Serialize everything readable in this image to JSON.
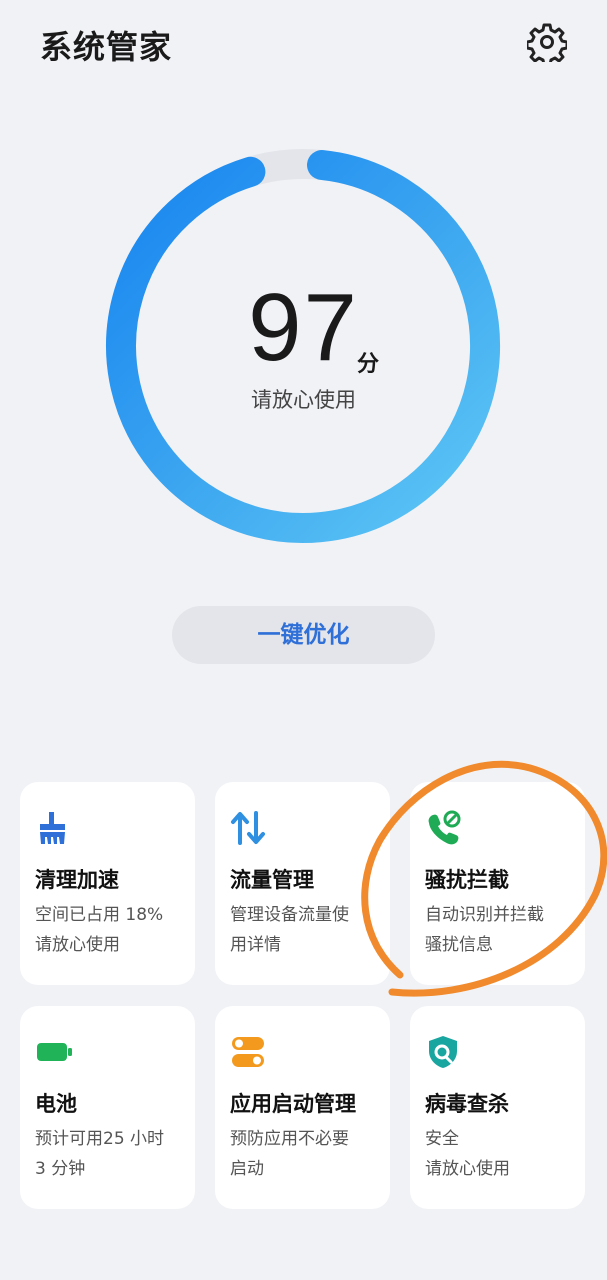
{
  "header": {
    "title": "系统管家",
    "settings_icon": "gear-icon"
  },
  "score": {
    "value": "97",
    "unit": "分",
    "status": "请放心使用",
    "fraction": 0.97
  },
  "optimize_button": "一键优化",
  "cards": [
    {
      "id": "clean",
      "icon": "broom-icon",
      "title": "清理加速",
      "desc": "空间已占用 18%\n请放心使用",
      "color": "#2f6fd8"
    },
    {
      "id": "traffic",
      "icon": "data-transfer-icon",
      "title": "流量管理",
      "desc": "管理设备流量使\n用详情",
      "color": "#2f8fe0"
    },
    {
      "id": "block",
      "icon": "phone-block-icon",
      "title": "骚扰拦截",
      "desc": "自动识别并拦截\n骚扰信息",
      "color": "#1faa55"
    },
    {
      "id": "battery",
      "icon": "battery-icon",
      "title": "电池",
      "desc": "预计可用25 小时\n3 分钟",
      "color": "#20b358"
    },
    {
      "id": "startup",
      "icon": "toggle-icon",
      "title": "应用启动管理",
      "desc": "预防应用不必要\n启动",
      "color": "#f39a1e"
    },
    {
      "id": "virus",
      "icon": "shield-scan-icon",
      "title": "病毒查杀",
      "desc": "安全\n请放心使用",
      "color": "#1aa6a0"
    }
  ],
  "colors": {
    "ring_start": "#1e8cf2",
    "ring_end": "#5ec8f5",
    "track": "#e3e5ea",
    "annotation": "#f08a2c"
  }
}
